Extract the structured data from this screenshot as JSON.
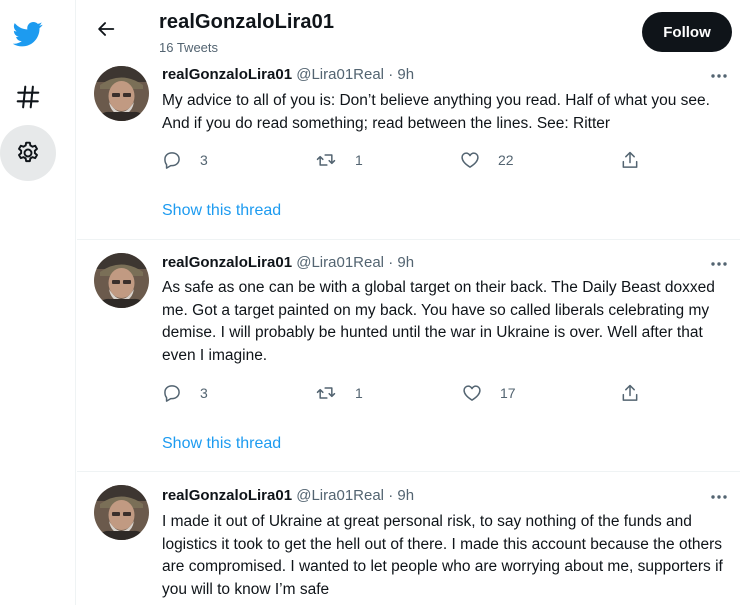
{
  "colors": {
    "accent": "#1d9bf0",
    "text": "#0f1419",
    "muted": "#536471",
    "follow_bg": "#0f1419"
  },
  "sidebar": {
    "items": [
      {
        "icon": "twitter-logo-icon"
      },
      {
        "icon": "hashtag-icon"
      },
      {
        "icon": "gear-icon"
      }
    ]
  },
  "header": {
    "back_icon": "arrow-left-icon",
    "name": "realGonzaloLira01",
    "tweet_count": "16 Tweets",
    "follow_label": "Follow"
  },
  "tweets": [
    {
      "author": "realGonzaloLira01",
      "handle": "@Lira01Real",
      "separator": "·",
      "time": "9h",
      "text": "My advice to all of you is: Don’t believe anything you read. Half of what you see. And if you do read something; read between the lines. See: Ritter",
      "replies": "3",
      "retweets": "1",
      "likes": "22",
      "thread_link": "Show this thread"
    },
    {
      "author": "realGonzaloLira01",
      "handle": "@Lira01Real",
      "separator": "·",
      "time": "9h",
      "text": "As safe as one can be with a global target on their back. The Daily Beast doxxed me. Got a target painted on my back. You have so called liberals celebrating my demise. I will probably be hunted until the war in Ukraine is over. Well after that even I imagine.",
      "replies": "3",
      "retweets": "1",
      "likes": "17",
      "thread_link": "Show this thread"
    },
    {
      "author": "realGonzaloLira01",
      "handle": "@Lira01Real",
      "separator": "·",
      "time": "9h",
      "text": "I made it out of Ukraine at great personal risk, to say nothing of the funds and logistics it took to get the hell out of there. I made this account because the others are compromised. I wanted to let people who are worrying about me, supporters if you will to know I’m safe"
    }
  ]
}
